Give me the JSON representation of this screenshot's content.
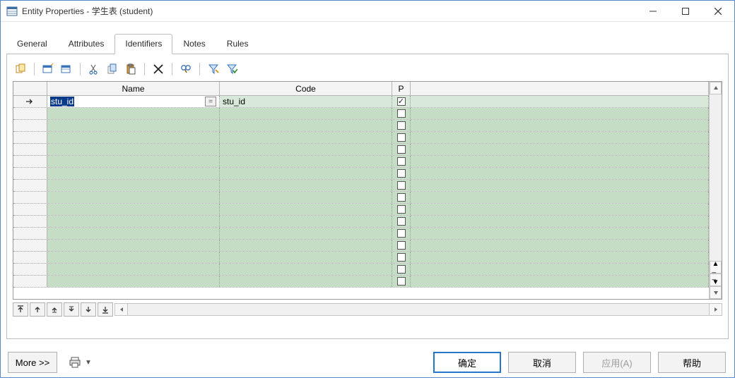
{
  "window": {
    "title": "Entity Properties - 学生表 (student)"
  },
  "tabs": [
    {
      "label": "General"
    },
    {
      "label": "Attributes"
    },
    {
      "label": "Identifiers",
      "active": true
    },
    {
      "label": "Notes"
    },
    {
      "label": "Rules"
    }
  ],
  "grid": {
    "headers": {
      "name": "Name",
      "code": "Code",
      "p": "P"
    },
    "rows": [
      {
        "name": "stu_id",
        "code": "stu_id",
        "p": true,
        "current": true
      }
    ],
    "empty_rows": 15
  },
  "buttons": {
    "more": "More >>",
    "ok": "确定",
    "cancel": "取消",
    "apply": "应用(A)",
    "help": "帮助"
  }
}
